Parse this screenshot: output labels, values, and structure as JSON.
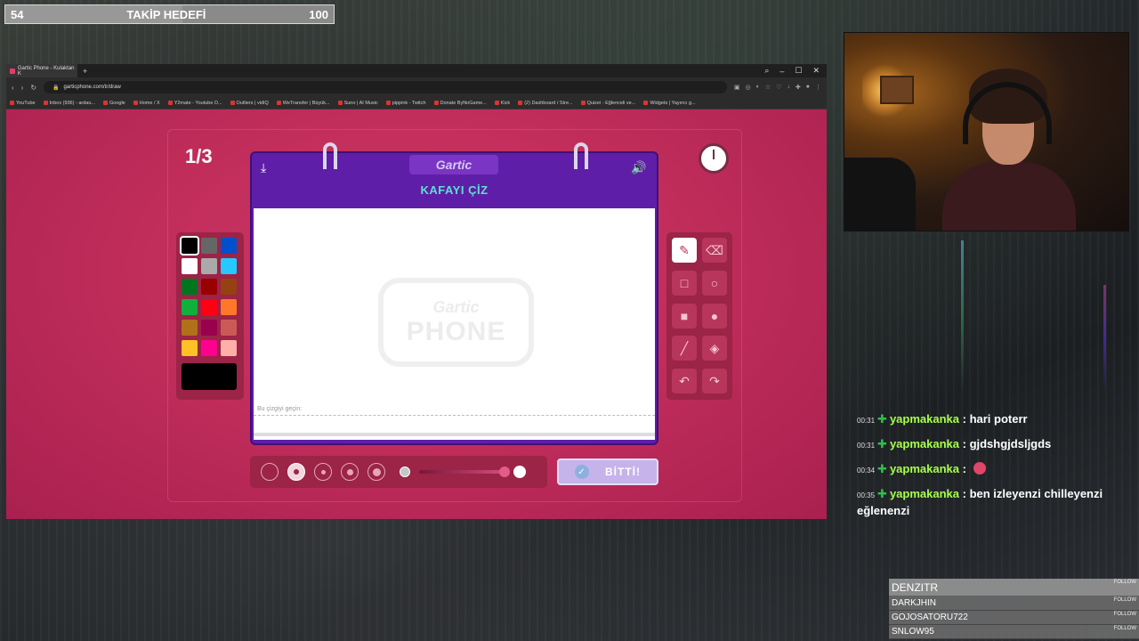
{
  "goal": {
    "current": "54",
    "label": "TAKİP HEDEFİ",
    "target": "100",
    "progress_fraction": 0.54
  },
  "browser": {
    "tab_title": "Gartic Phone - Kulaktan K",
    "url": "garticphone.com/tr/draw",
    "bookmarks": [
      "YouTube",
      "Inbox (936) - ardau...",
      "Google",
      "Home / X",
      "Y2mate - Youtube D...",
      "Outliers | vidIQ",
      "WeTransfer | Büyük...",
      "Suno | AI Music",
      "pippink - Twitch",
      "Donate ByNoGame...",
      "Kick",
      "(2) Dashboard / Stre...",
      "Quizei - Eğlenceli ve...",
      "Widgets | Yayıncı g..."
    ]
  },
  "game": {
    "round": "1/3",
    "brand": "Gartic",
    "title": "KAFAYI ÇİZ",
    "watermark_top": "Gartic",
    "watermark_bottom": "PHONE",
    "line_hint": "Bu çizgiyi geçin:",
    "done_label": "BİTTİ!",
    "colors": [
      "#000000",
      "#666666",
      "#0050cd",
      "#ffffff",
      "#aaaaaa",
      "#26c9ff",
      "#017420",
      "#990000",
      "#964112",
      "#11b03c",
      "#ff0013",
      "#ff7829",
      "#b0701c",
      "#99004e",
      "#cb5a57",
      "#ffc126",
      "#ff008f",
      "#feafa8"
    ],
    "selected_color": "#000000",
    "tools": [
      "pencil-icon",
      "eraser-icon",
      "rect-outline-icon",
      "circle-outline-icon",
      "rect-filled-icon",
      "circle-filled-icon",
      "line-icon",
      "fill-icon",
      "undo-icon",
      "redo-icon"
    ],
    "active_tool": "pencil-icon",
    "sizes": 5,
    "selected_size_index": 1,
    "opacity_fraction": 1.0
  },
  "chat": [
    {
      "time": "00:31",
      "user": "yapmakanka",
      "message": "hari poterr"
    },
    {
      "time": "00:31",
      "user": "yapmakanka",
      "message": "gjdshgjdsljgds"
    },
    {
      "time": "00:34",
      "user": "yapmakanka",
      "message": ""
    },
    {
      "time": "00:35",
      "user": "yapmakanka",
      "message": "ben izleyenzi chilleyenzi eğlenenzi"
    }
  ],
  "followers": {
    "tag": "FOLLOW",
    "names": [
      "DENZITR",
      "DARKJHIN",
      "GOJOSATORU722",
      "SNLOW95"
    ]
  }
}
